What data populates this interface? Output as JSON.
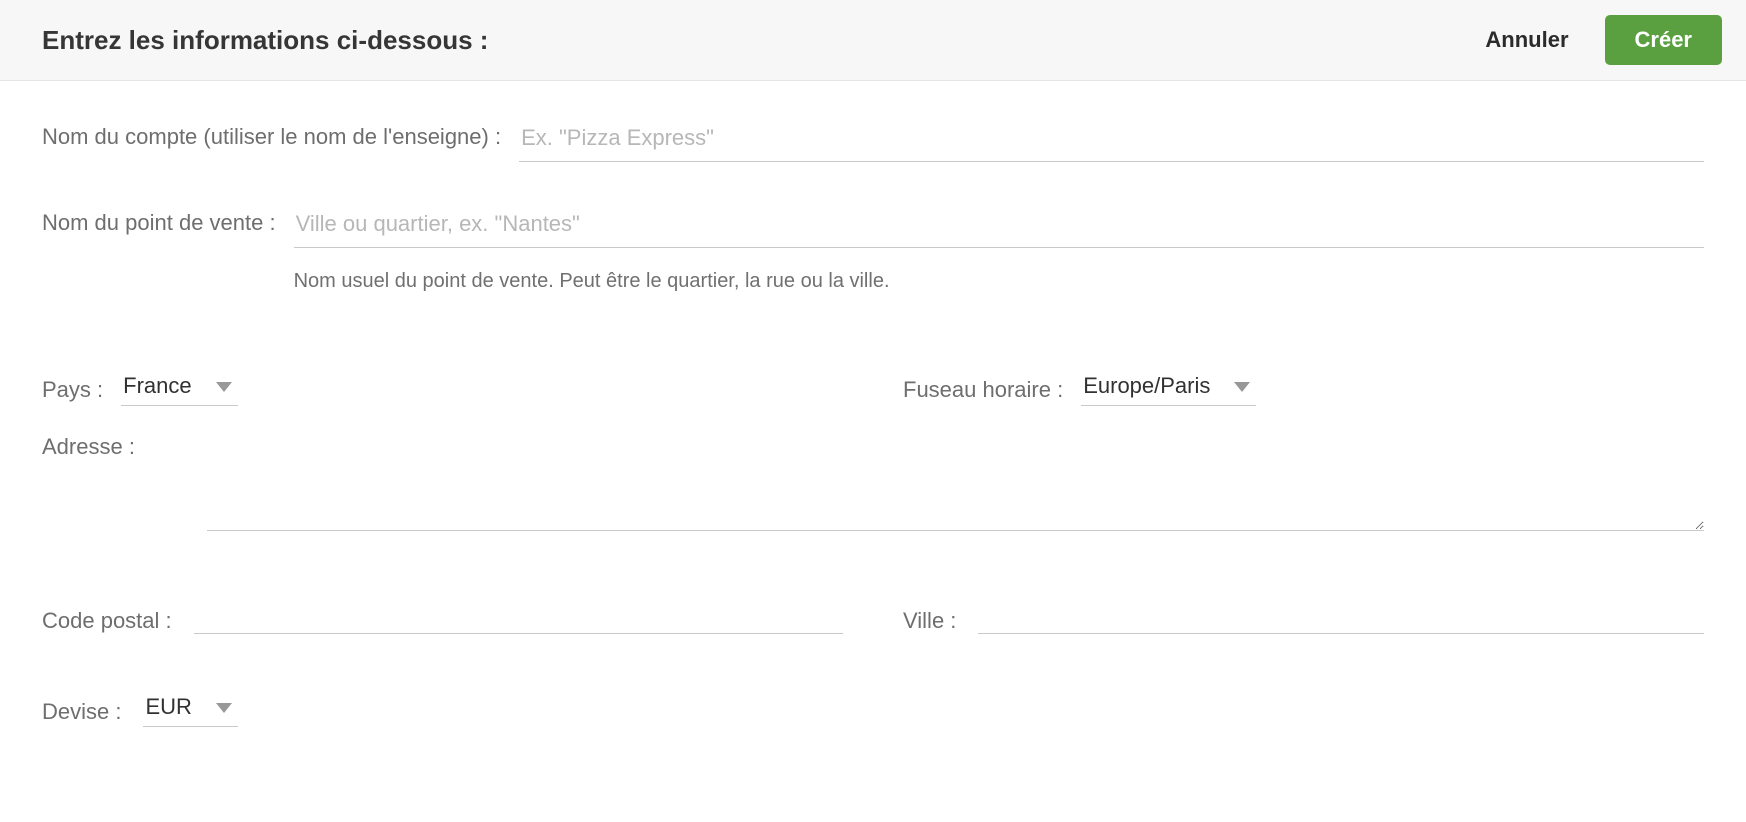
{
  "header": {
    "title": "Entrez les informations ci-dessous :",
    "cancel": "Annuler",
    "create": "Créer"
  },
  "form": {
    "account_name_label": "Nom du compte (utiliser le nom de l'enseigne) :",
    "account_name_placeholder": "Ex. \"Pizza Express\"",
    "pos_name_label": "Nom du point de vente :",
    "pos_name_placeholder": "Ville ou quartier, ex. \"Nantes\"",
    "pos_name_help": "Nom usuel du point de vente. Peut être le quartier, la rue ou la ville.",
    "country_label": "Pays :",
    "country_value": "France",
    "timezone_label": "Fuseau horaire :",
    "timezone_value": "Europe/Paris",
    "address_label": "Adresse :",
    "postal_label": "Code postal :",
    "city_label": "Ville :",
    "currency_label": "Devise :",
    "currency_value": "EUR"
  }
}
